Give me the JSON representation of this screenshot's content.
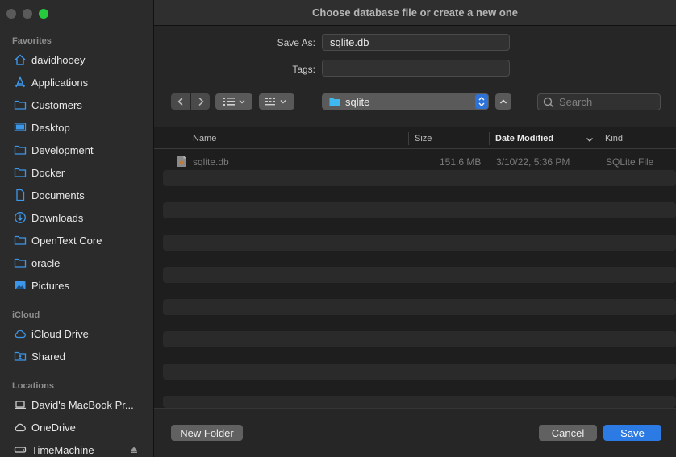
{
  "window": {
    "title": "Choose database file or create a new one"
  },
  "sidebar": {
    "sections": [
      {
        "title": "Favorites",
        "items": [
          {
            "label": "davidhooey",
            "icon": "home-icon"
          },
          {
            "label": "Applications",
            "icon": "applications-icon"
          },
          {
            "label": "Customers",
            "icon": "folder-icon"
          },
          {
            "label": "Desktop",
            "icon": "desktop-icon"
          },
          {
            "label": "Development",
            "icon": "folder-icon"
          },
          {
            "label": "Docker",
            "icon": "folder-icon"
          },
          {
            "label": "Documents",
            "icon": "document-icon"
          },
          {
            "label": "Downloads",
            "icon": "download-icon"
          },
          {
            "label": "OpenText Core",
            "icon": "folder-icon"
          },
          {
            "label": "oracle",
            "icon": "folder-icon"
          },
          {
            "label": "Pictures",
            "icon": "pictures-icon"
          }
        ]
      },
      {
        "title": "iCloud",
        "items": [
          {
            "label": "iCloud Drive",
            "icon": "cloud-icon"
          },
          {
            "label": "Shared",
            "icon": "shared-folder-icon"
          }
        ]
      },
      {
        "title": "Locations",
        "items": [
          {
            "label": "David's MacBook Pr...",
            "icon": "laptop-icon"
          },
          {
            "label": "OneDrive",
            "icon": "cloud-outline-icon"
          },
          {
            "label": "TimeMachine",
            "icon": "drive-icon"
          }
        ]
      }
    ]
  },
  "form": {
    "save_as_label": "Save As:",
    "save_as_value": "sqlite.db",
    "tags_label": "Tags:",
    "tags_value": ""
  },
  "toolbar": {
    "location": "sqlite",
    "search_placeholder": "Search"
  },
  "table": {
    "columns": {
      "name": "Name",
      "size": "Size",
      "date": "Date Modified",
      "kind": "Kind"
    },
    "rows": [
      {
        "name": "sqlite.db",
        "size": "151.6 MB",
        "date": "3/10/22, 5:36 PM",
        "kind": "SQLite File"
      }
    ]
  },
  "buttons": {
    "new_folder": "New Folder",
    "cancel": "Cancel",
    "save": "Save"
  },
  "colors": {
    "accent": "#2c7be5",
    "sidebar_icon": "#3b97ea"
  }
}
